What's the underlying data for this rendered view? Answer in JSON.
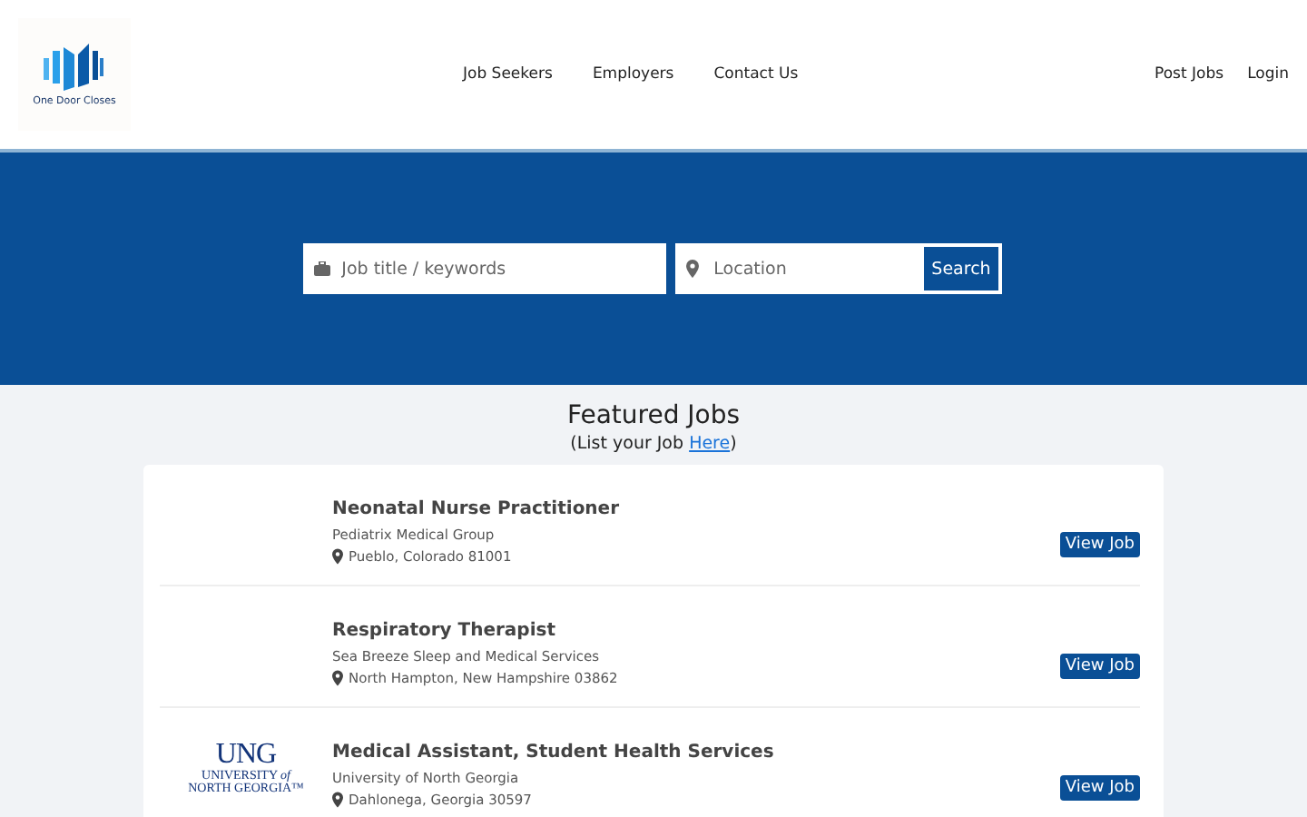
{
  "brand": {
    "name": "One Door Closes"
  },
  "nav": {
    "center": [
      "Job Seekers",
      "Employers",
      "Contact Us"
    ],
    "right": [
      "Post Jobs",
      "Login"
    ]
  },
  "search": {
    "keyword_placeholder": "Job title / keywords",
    "location_placeholder": "Location",
    "button": "Search"
  },
  "featured": {
    "title": "Featured Jobs",
    "subtitle_before": "(List your Job ",
    "subtitle_link": "Here",
    "subtitle_after": ")"
  },
  "jobs": [
    {
      "title": "Neonatal Nurse Practitioner",
      "company": "Pediatrix Medical Group",
      "location": "Pueblo, Colorado 81001",
      "button": "View Job"
    },
    {
      "title": "Respiratory Therapist",
      "company": "Sea Breeze Sleep and Medical Services",
      "location": "North Hampton, New Hampshire 03862",
      "button": "View Job"
    },
    {
      "title": "Medical Assistant, Student Health Services",
      "company": "University of North Georgia",
      "location": "Dahlonega, Georgia 30597",
      "button": "View Job",
      "logo": {
        "initials": "UNG",
        "line1": "UNIVERSITY *of*",
        "line2": "NORTH GEORGIA™"
      }
    }
  ]
}
